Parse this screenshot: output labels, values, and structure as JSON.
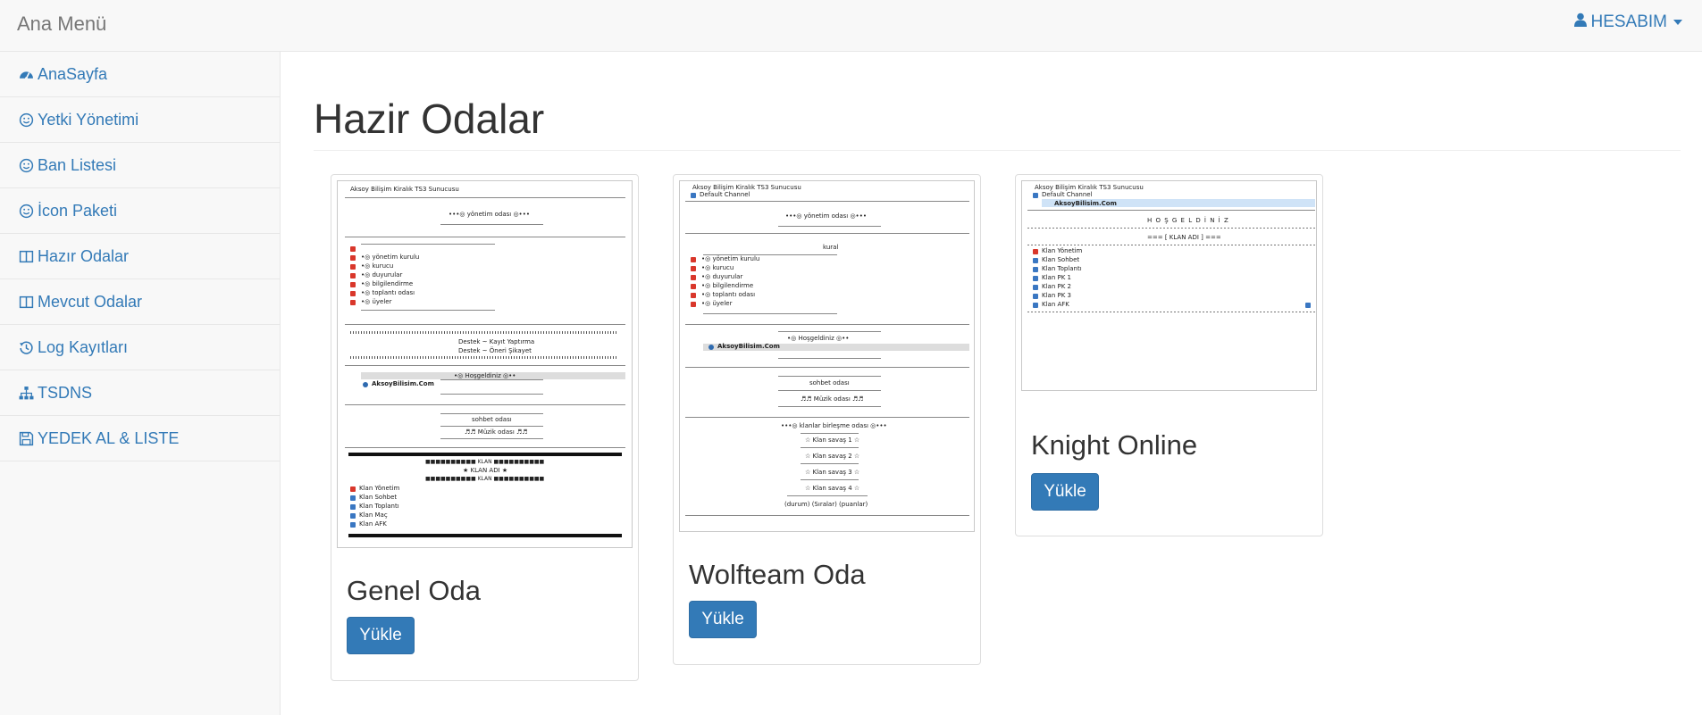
{
  "navbar": {
    "brand": "Ana Menü",
    "account_label": "HESABIM"
  },
  "sidebar": {
    "items": [
      {
        "label": "AnaSayfa",
        "icon": "dashboard-icon"
      },
      {
        "label": "Yetki Yönetimi",
        "icon": "smile-icon"
      },
      {
        "label": "Ban Listesi",
        "icon": "smile-icon"
      },
      {
        "label": "İcon Paketi",
        "icon": "smile-icon"
      },
      {
        "label": "Hazır Odalar",
        "icon": "columns-icon"
      },
      {
        "label": "Mevcut Odalar",
        "icon": "columns-icon"
      },
      {
        "label": "Log Kayıtları",
        "icon": "history-icon"
      },
      {
        "label": "TSDNS",
        "icon": "sitemap-icon"
      },
      {
        "label": "YEDEK AL & LISTE",
        "icon": "save-icon"
      }
    ]
  },
  "main": {
    "title": "Hazir Odalar",
    "cards": [
      {
        "title": "Genel Oda",
        "button": "Yükle",
        "preview": {
          "header": "Aksoy Bilişim Kiralık TS3 Sunucusu",
          "lines": [
            "•••◎ yönetim odası ◎•••",
            "•◎ yönetim kurulu",
            "•◎ kurucu",
            "•◎ duyurular",
            "•◎ bilgilendirme",
            "•◎ toplantı odası",
            "•◎ üyeler",
            "Destek ~ Kayıt Yaptırma",
            "Destek ~ Öneri Şikayet",
            "•◎ Hoşgeldiniz ◎••",
            "AksoyBilisim.Com",
            "sohbet odası",
            "♬♬ Müzik odası ♬♬",
            "■■■■■■■■■■ KLAN ■■■■■■■■■■",
            "★ KLAN ADI ★",
            "Klan Yönetim",
            "Klan Sohbet",
            "Klan Toplantı",
            "Klan Maç",
            "Klan AFK"
          ]
        }
      },
      {
        "title": "Wolfteam Oda",
        "button": "Yükle",
        "preview": {
          "header": "Aksoy Bilişim Kiralık TS3 Sunucusu",
          "channel": "Default Channel",
          "lines": [
            "•••◎ yönetim odası ◎•••",
            "kural",
            "•◎ yönetim kurulu",
            "•◎ kurucu",
            "•◎ duyurular",
            "•◎ bilgilendirme",
            "•◎ toplantı odası",
            "•◎ üyeler",
            "•◎ Hoşgeldiniz ◎••",
            "AksoyBilisim.Com",
            "sohbet odası",
            "♬♬ Müzik odası ♬♬",
            "•••◎ klanlar birleşme odası ◎•••",
            "☆ Klan savaş 1 ☆",
            "☆ Klan savaş 2 ☆",
            "☆ Klan savaş 3 ☆",
            "☆ Klan savaş 4 ☆",
            "(durum) (Sıralar) (puanlar)"
          ]
        }
      },
      {
        "title": "Knight Online",
        "button": "Yükle",
        "preview": {
          "header": "Aksoy Bilişim Kiralık TS3 Sunucusu",
          "channel": "Default Channel",
          "server": "AksoyBilisim.Com",
          "lines": [
            "H O Ş G E L D İ N İ Z",
            "=== [ KLAN ADI ] ===",
            "Klan Yönetim",
            "Klan Sohbet",
            "Klan Toplantı",
            "Klan PK 1",
            "Klan PK 2",
            "Klan PK 3",
            "Klan AFK"
          ]
        }
      }
    ]
  },
  "colors": {
    "link": "#337ab7",
    "button": "#337ab7",
    "navbar_bg": "#f8f8f8"
  }
}
